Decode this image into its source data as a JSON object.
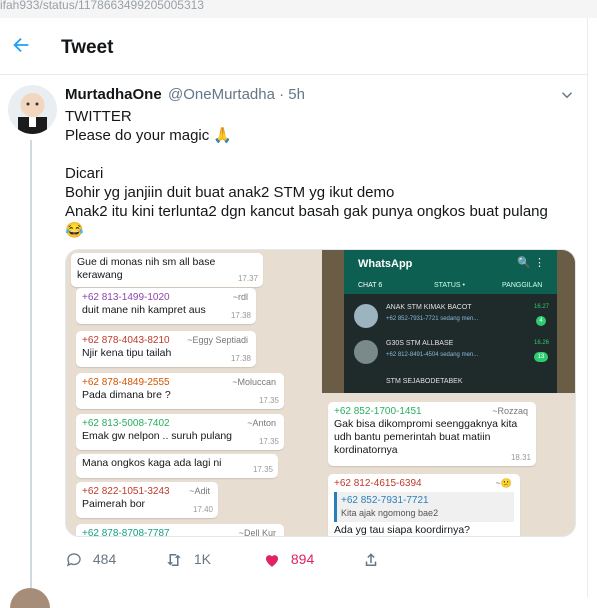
{
  "url_bar": "ifah933/status/1178663499205005313",
  "header": {
    "back_icon": "arrow-left-icon",
    "title": "Tweet"
  },
  "tweet": {
    "display_name": "MurtadhaOne",
    "handle": "@OneMurtadha",
    "sep": "·",
    "time": "5h",
    "text": "TWITTER\nPlease do your magic 🙏\n\nDicari\nBohir yg janjiin duit buat anak2 STM yg ikut demo\nAnak2 itu kini terlunta2 dgn kancut basah gak punya ongkos buat pulang\n😂"
  },
  "chat_left": [
    {
      "text": "Gue di monas nih sm all base kerawang",
      "time": "17.37"
    },
    {
      "number": "+62 813-1499-1020",
      "alias": "~rdl",
      "text": "duit mane nih kampret aus",
      "time": "17.38"
    },
    {
      "number": "+62 878-4043-8210",
      "alias": "~Eggy Septiadi",
      "text": "Njir kena tipu tailah",
      "time": "17.38"
    },
    {
      "number": "+62 878-4849-2555",
      "alias": "~Moluccan",
      "text": "Pada dimana bre ?",
      "time": "17.35"
    },
    {
      "number": "+62 813-5008-7402",
      "alias": "~Anton",
      "text": "Emak gw nelpon .. suruh pulang",
      "time": "17.35"
    },
    {
      "text": "Mana ongkos kaga ada lagi ni",
      "time": "17.35"
    },
    {
      "number": "+62 822-1051-3243",
      "alias": "~Adit",
      "text": "Paimerah bor",
      "time": "17.40"
    },
    {
      "number": "+62 878-8708-7787",
      "alias": "~Dell Kur",
      "text": "",
      "time": ""
    }
  ],
  "whatsapp": {
    "title": "WhatsApp",
    "tabs": [
      "CHAT 6",
      "STATUS •",
      "PANGGILAN"
    ],
    "chats": [
      {
        "name": "ANAK STM KIMAK BACOT",
        "preview": "+62 852-7931-7721 sedang men...",
        "time": "16.27",
        "badge": "4"
      },
      {
        "name": "G30S STM ALLBASE",
        "preview": "+62 812-8491-4504 sedang men...",
        "time": "16.26",
        "badge": "13"
      },
      {
        "name": "STM SEJABODETABEK",
        "preview": "",
        "time": "",
        "badge": ""
      }
    ]
  },
  "chat_right": [
    {
      "number": "+62 852-1700-1451",
      "alias": "~Rozzaq",
      "text": "Gak bisa dikompromi seenggaknya kita udh bantu pemerintah buat matiin kordinatornya",
      "time": "18.31"
    },
    {
      "number": "+62 812-4615-6394",
      "alias": "~😕",
      "quote_number": "+62 852-7931-7721",
      "quote_text": "Kita ajak ngomong bae2",
      "text": "Ada yg tau siapa koordirnya?",
      "time": ""
    }
  ],
  "actions": {
    "reply_count": "484",
    "retweet_count": "1K",
    "like_count": "894",
    "like_color": "#e0245e"
  }
}
